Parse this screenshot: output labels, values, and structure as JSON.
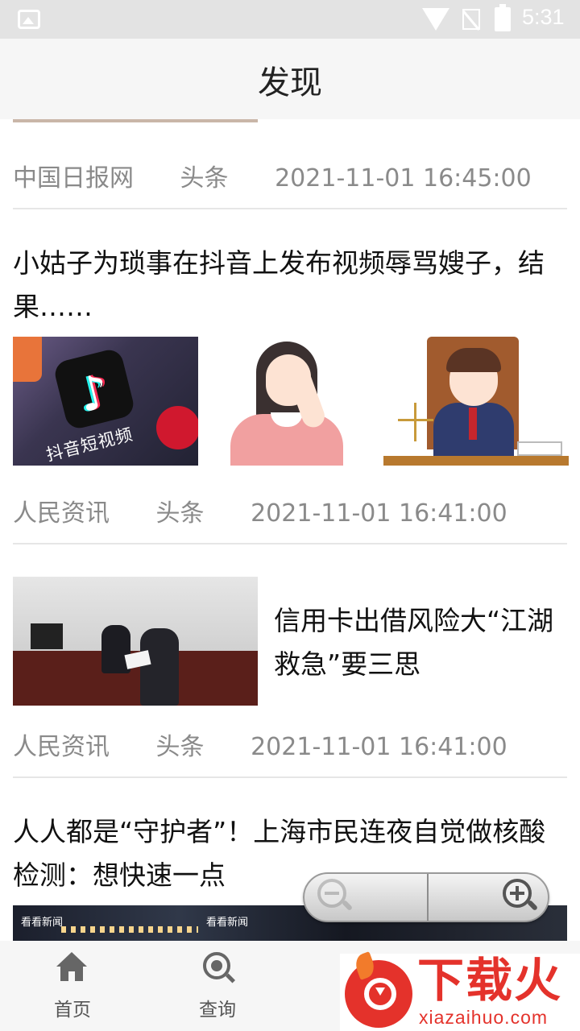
{
  "status_bar": {
    "time": "5:31"
  },
  "header": {
    "title": "发现"
  },
  "feed": [
    {
      "source": "中国日报网",
      "tag": "头条",
      "time": "2021-11-01 16:45:00"
    },
    {
      "title": "小姑子为琐事在抖音上发布视频辱骂嫂子，结果……",
      "thumb_caption": "抖音短视频",
      "source": "人民资讯",
      "tag": "头条",
      "time": "2021-11-01 16:41:00"
    },
    {
      "title": "信用卡出借风险大“江湖救急”要三思",
      "source": "人民资讯",
      "tag": "头条",
      "time": "2021-11-01 16:41:00"
    },
    {
      "title": "人人都是“守护者”！上海市民连夜自觉做核酸检测：想快速一点",
      "thumb_logo": "看看新闻"
    }
  ],
  "zoom_controls": {
    "zoom_out_icon": "zoom-out-icon",
    "zoom_in_icon": "zoom-in-icon"
  },
  "bottom_nav": [
    {
      "label": "首页",
      "icon": "home-icon"
    },
    {
      "label": "查询",
      "icon": "search-icon"
    }
  ],
  "watermark": {
    "text": "下载火",
    "domain": "xiazaihuo.com",
    "color": "#e4322b"
  }
}
